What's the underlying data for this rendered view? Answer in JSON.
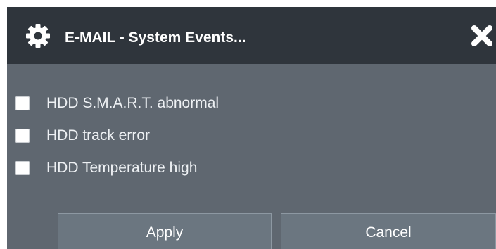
{
  "dialog": {
    "title": "E-MAIL - System Events...",
    "icon": "gear-icon",
    "close_icon": "close-icon"
  },
  "options": [
    {
      "label": "HDD S.M.A.R.T. abnormal",
      "checked": false
    },
    {
      "label": "HDD track error",
      "checked": false
    },
    {
      "label": "HDD Temperature high",
      "checked": false
    }
  ],
  "buttons": {
    "apply_label": "Apply",
    "cancel_label": "Cancel"
  },
  "colors": {
    "titlebar": "#2f353c",
    "body": "#5f6770",
    "button": "#6b7680"
  }
}
